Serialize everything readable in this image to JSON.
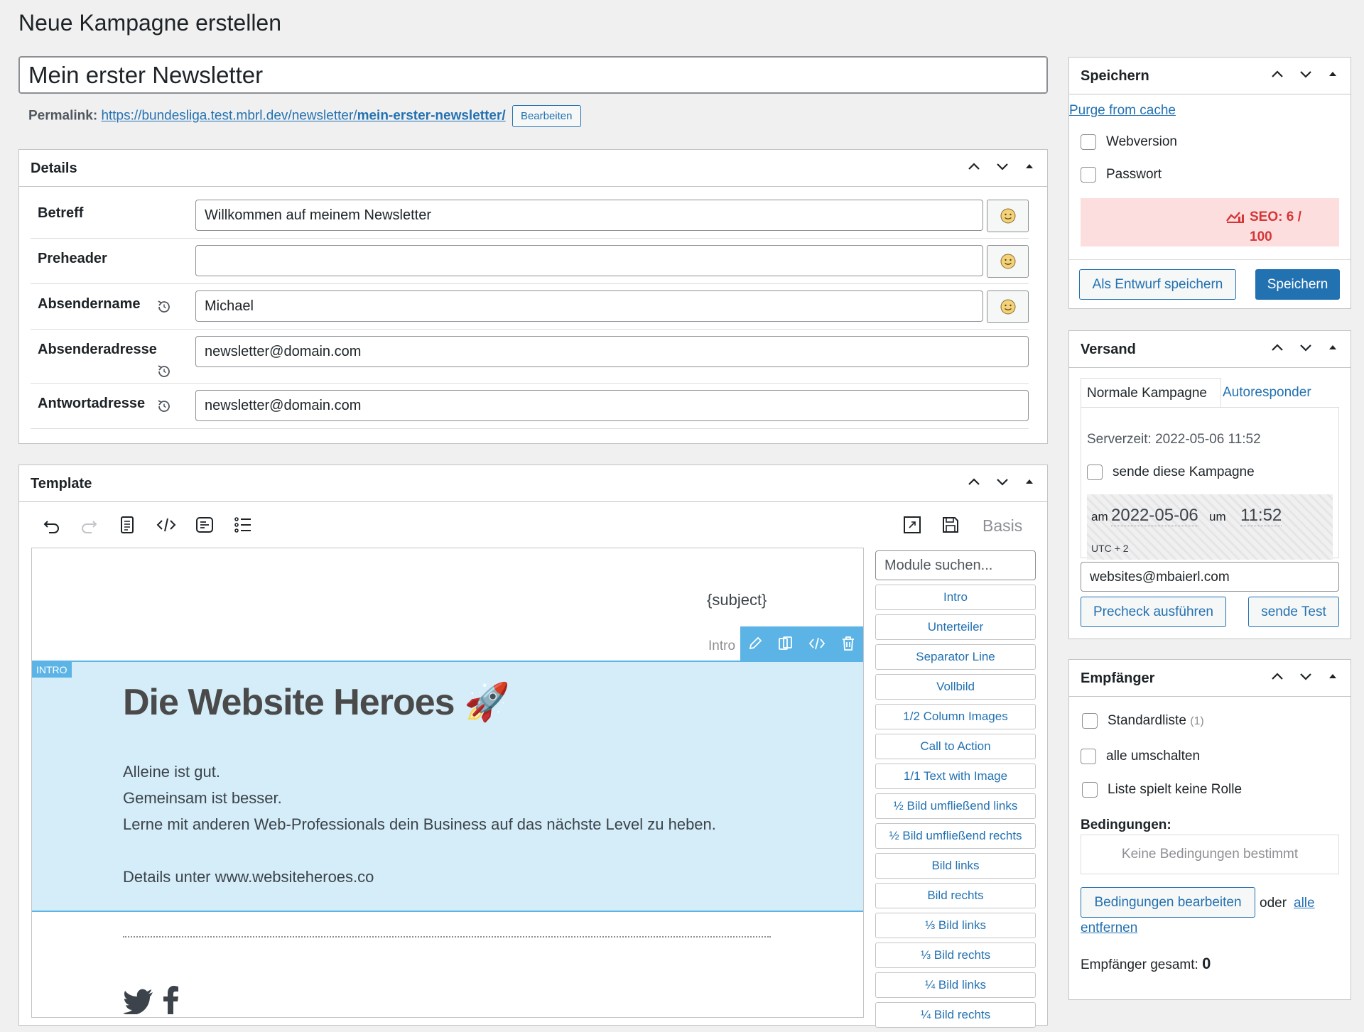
{
  "page": {
    "title": "Neue Kampagne erstellen"
  },
  "title_field": {
    "value": "Mein erster Newsletter"
  },
  "permalink": {
    "label": "Permalink:",
    "url_base": "https://bundesliga.test.mbrl.dev/newsletter/",
    "url_slug": "mein-erster-newsletter/",
    "edit_label": "Bearbeiten"
  },
  "details": {
    "title": "Details",
    "rows": [
      {
        "label": "Betreff",
        "value": "Willkommen auf meinem Newsletter"
      },
      {
        "label": "Preheader",
        "value": ""
      },
      {
        "label": "Absendername",
        "value": "Michael"
      },
      {
        "label": "Absenderadresse",
        "value": "newsletter@domain.com"
      },
      {
        "label": "Antwortadresse",
        "value": "newsletter@domain.com"
      }
    ]
  },
  "template": {
    "title": "Template",
    "mode_label": "Basis",
    "module_search_placeholder": "Module suchen...",
    "modules": [
      "Intro",
      "Unterteiler",
      "Separator Line",
      "Vollbild",
      "1/2 Column Images",
      "Call to Action",
      "1/1 Text with Image",
      "½ Bild umfließend links",
      "½ Bild umfließend rechts",
      "Bild links",
      "Bild rechts",
      "⅓ Bild links",
      "⅓ Bild rechts",
      "¼ Bild links",
      "¼ Bild rechts"
    ],
    "canvas": {
      "subject_tag": "{subject}",
      "module_hover_label": "Intro",
      "intro_badge": "INTRO",
      "headline": "Die Website Heroes 🚀",
      "lines": [
        "Alleine ist gut.",
        "Gemeinsam ist besser.",
        "Lerne mit anderen Web-Professionals dein Business auf das nächste Level zu heben."
      ],
      "details_line": "Details unter www.websiteheroes.co"
    }
  },
  "save_box": {
    "title": "Speichern",
    "purge_link": "Purge from cache",
    "webversion_label": "Webversion",
    "password_label": "Passwort",
    "seo_line1": "SEO: 6 /",
    "seo_line2": "100",
    "draft_button": "Als Entwurf speichern",
    "save_button": "Speichern"
  },
  "versand": {
    "title": "Versand",
    "tab_normal": "Normale Kampagne",
    "tab_auto": "Autoresponder",
    "server_time": "Serverzeit: 2022-05-06 11:52",
    "send_label": "sende diese Kampagne",
    "am_label": "am",
    "date": "2022-05-06",
    "um_label": "um",
    "time": "11:52",
    "timezone": "UTC + 2",
    "test_email": "websites@mbaierl.com",
    "precheck_button": "Precheck ausführen",
    "send_test_button": "sende Test"
  },
  "recipients": {
    "title": "Empfänger",
    "list_label": "Standardliste",
    "list_count": "(1)",
    "toggle_all": "alle umschalten",
    "list_no_role": "Liste spielt keine Rolle",
    "conditions_label": "Bedingungen:",
    "no_conditions": "Keine Bedingungen bestimmt",
    "edit_conditions": "Bedingungen bearbeiten",
    "or_text": "oder",
    "remove_all_1": "alle",
    "remove_all_2": "entfernen",
    "total_label": "Empfänger gesamt:",
    "total_value": "0"
  },
  "colors": {
    "accent": "#2271b1",
    "intro_bg": "#d4edf8",
    "seo_bg": "#fcdede",
    "seo_text": "#d63638"
  }
}
